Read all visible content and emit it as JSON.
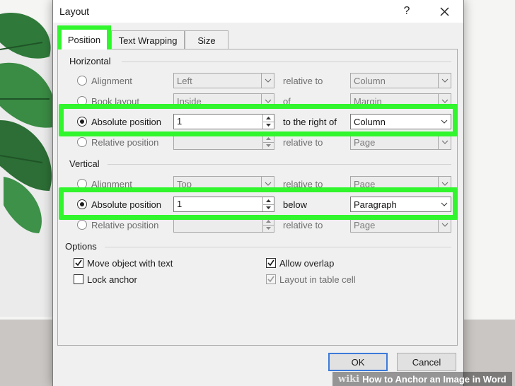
{
  "dialog": {
    "title": "Layout",
    "help_glyph": "?",
    "tabs": [
      {
        "label": "Position",
        "selected": true
      },
      {
        "label": "Text Wrapping",
        "selected": false
      },
      {
        "label": "Size",
        "selected": false
      }
    ]
  },
  "horizontal": {
    "heading": "Horizontal",
    "rows": [
      {
        "label": "Alignment",
        "checked": false,
        "value": "Left",
        "relation": "relative to",
        "target": "Column"
      },
      {
        "label": "Book layout",
        "checked": false,
        "value": "Inside",
        "relation": "of",
        "target": "Margin"
      },
      {
        "label": "Absolute position",
        "checked": true,
        "value": "1",
        "relation": "to the right of",
        "target": "Column"
      },
      {
        "label": "Relative position",
        "checked": false,
        "value": "",
        "relation": "relative to",
        "target": "Page"
      }
    ]
  },
  "vertical": {
    "heading": "Vertical",
    "rows": [
      {
        "label": "Alignment",
        "checked": false,
        "value": "Top",
        "relation": "relative to",
        "target": "Page"
      },
      {
        "label": "Absolute position",
        "checked": true,
        "value": "1",
        "relation": "below",
        "target": "Paragraph"
      },
      {
        "label": "Relative position",
        "checked": false,
        "value": "",
        "relation": "relative to",
        "target": "Page"
      }
    ]
  },
  "options": {
    "heading": "Options",
    "move_object_with_text": {
      "label": "Move object with text",
      "checked": true
    },
    "lock_anchor": {
      "label": "Lock anchor",
      "checked": false
    },
    "allow_overlap": {
      "label": "Allow overlap",
      "checked": true
    },
    "layout_in_table_cell": {
      "label": "Layout in table cell",
      "checked": true,
      "disabled": true
    }
  },
  "buttons": {
    "ok": "OK",
    "cancel": "Cancel"
  },
  "watermark": {
    "logo": "wiki",
    "text": "How to Anchor an Image in Word"
  },
  "colors": {
    "highlight": "#31f52d",
    "ok_border": "#3d7bd9"
  }
}
